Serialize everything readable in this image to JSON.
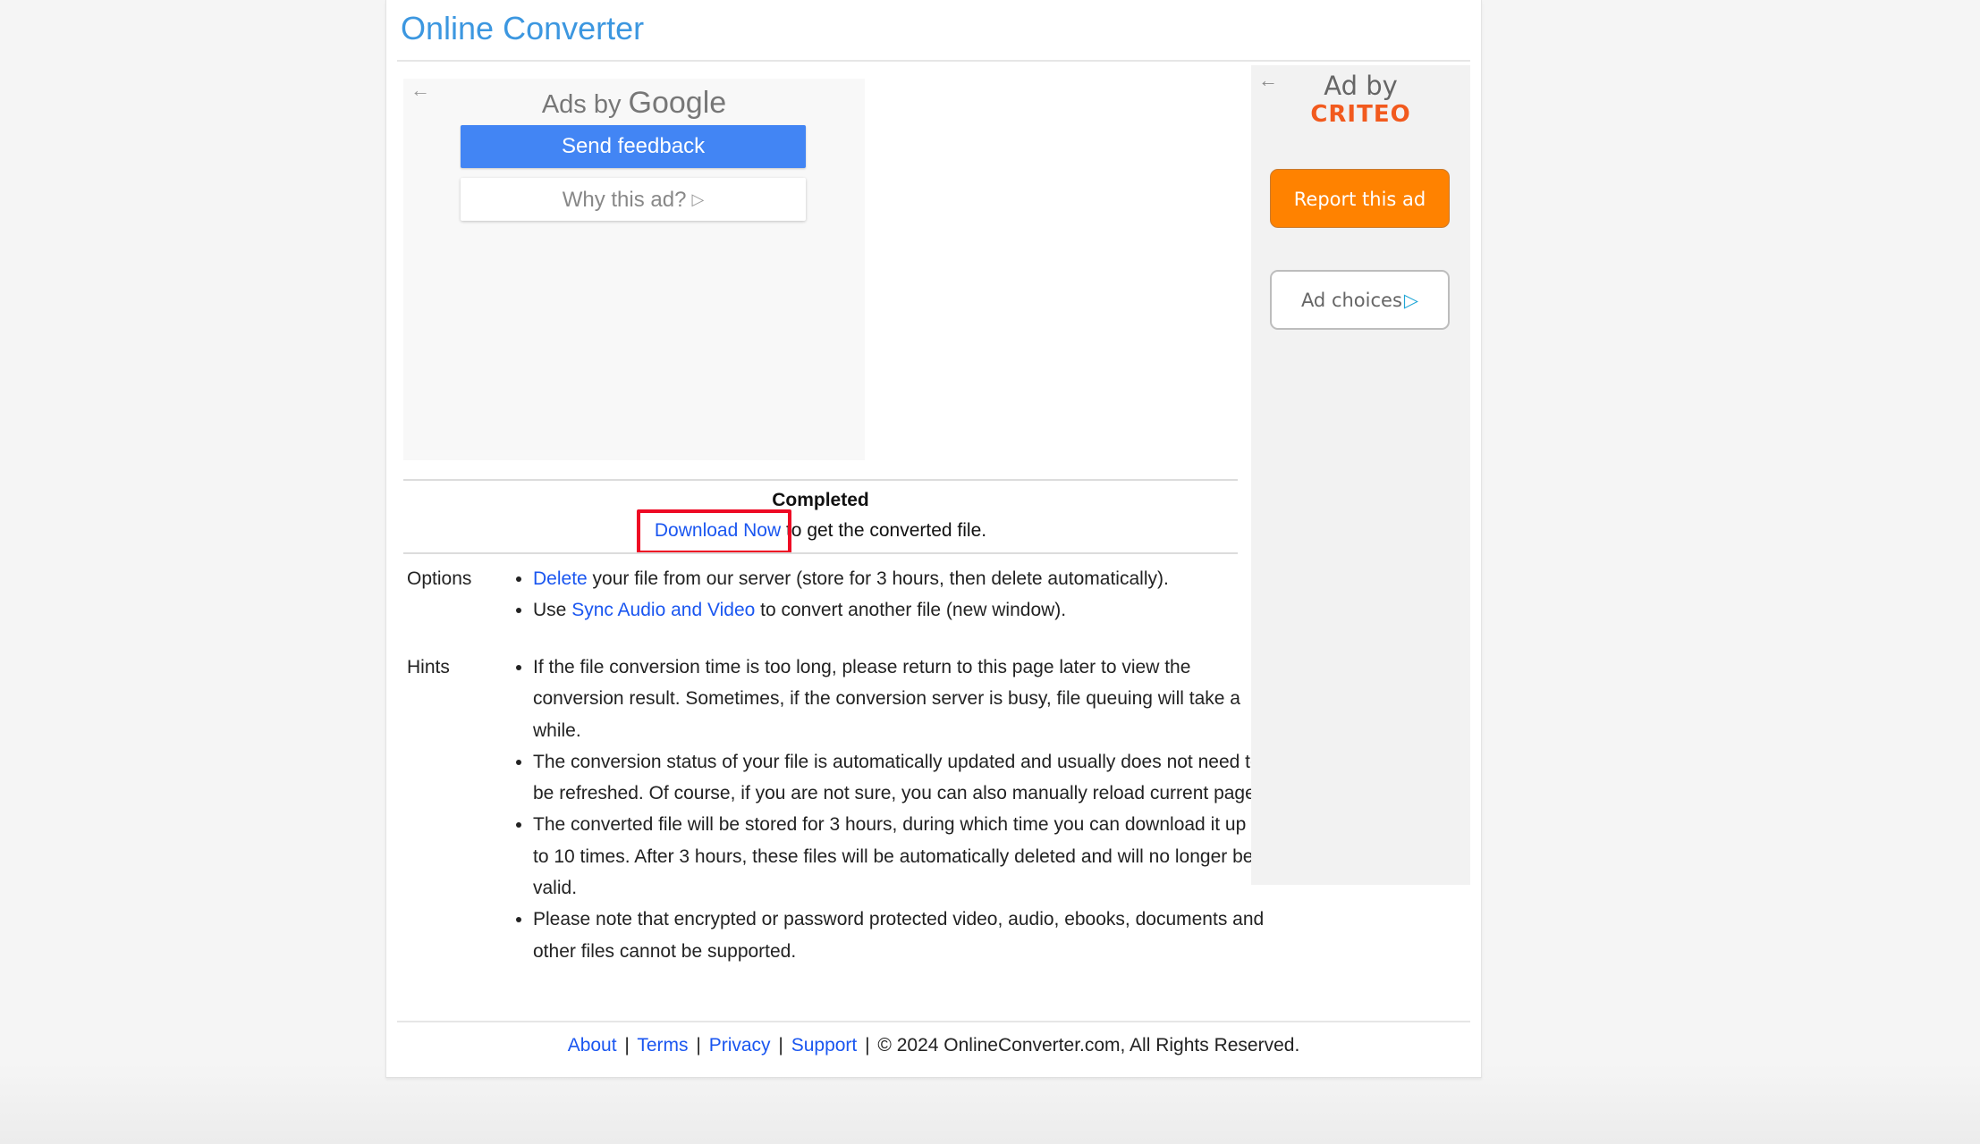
{
  "header": {
    "title": "Online Converter"
  },
  "google_ad": {
    "back_icon": "←",
    "ads_by_prefix": "Ads by",
    "ads_by_brand": "Google",
    "send_feedback_label": "Send feedback",
    "why_this_ad_label": "Why this ad?",
    "why_icon": "▷"
  },
  "status": {
    "title": "Completed",
    "download_link": "Download Now",
    "download_suffix": "to get the converted file."
  },
  "options": {
    "label": "Options",
    "items": [
      {
        "link": "Delete",
        "prefix": "",
        "suffix": " your file from our server (store for 3 hours, then delete automatically)."
      },
      {
        "prefix": "Use ",
        "link": "Sync Audio and Video",
        "suffix": " to convert another file (new window)."
      }
    ]
  },
  "hints": {
    "label": "Hints",
    "items": [
      "If the file conversion time is too long, please return to this page later to view the conversion result. Sometimes, if the conversion server is busy, file queuing will take a while.",
      "The conversion status of your file is automatically updated and usually does not need to be refreshed. Of course, if you are not sure, you can also manually reload current page.",
      "The converted file will be stored for 3 hours, during which time you can download it up to 10 times. After 3 hours, these files will be automatically deleted and will no longer be valid.",
      "Please note that encrypted or password protected video, audio, ebooks, documents and other files cannot be supported."
    ]
  },
  "criteo_ad": {
    "back_icon": "←",
    "ad_by": "Ad by",
    "brand": "CRITEO",
    "report_label": "Report this ad",
    "ad_choices_label": "Ad choices",
    "ad_choices_icon": "▷",
    "brand_color": "#f25a1e",
    "report_color": "#ff8200"
  },
  "footer": {
    "links": [
      "About",
      "Terms",
      "Privacy",
      "Support"
    ],
    "separator": "|",
    "copyright": "© 2024 OnlineConverter.com, All Rights Reserved."
  },
  "colors": {
    "title": "#3c97e0",
    "link": "#1a56f0",
    "google_button": "#4285f4",
    "highlight": "#ee0a24"
  }
}
